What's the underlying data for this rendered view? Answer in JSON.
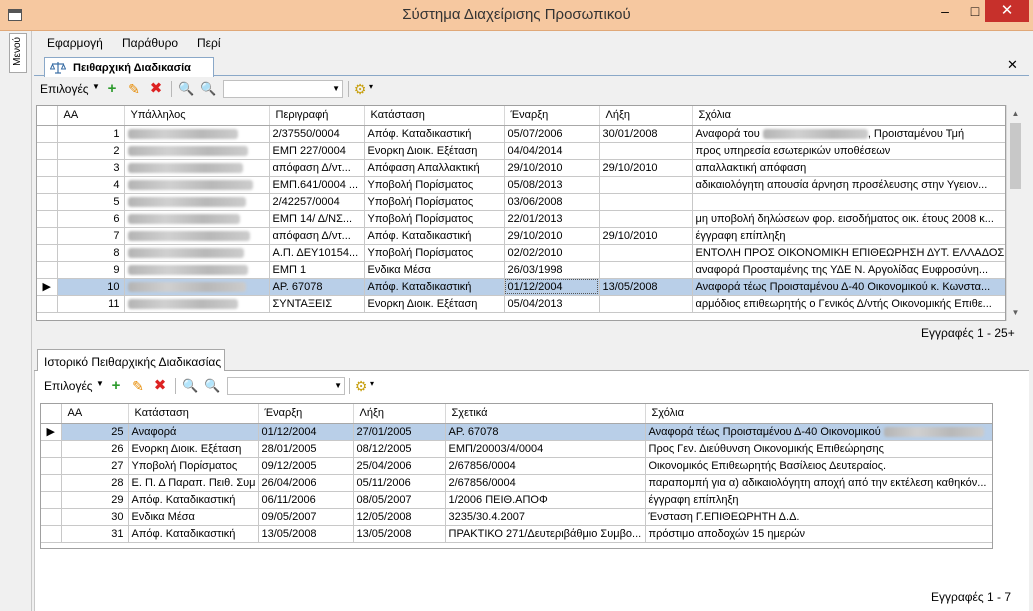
{
  "window": {
    "title": "Σύστημα Διαχείρισης Προσωπικού",
    "min": "‒",
    "max": "□",
    "close": "✕"
  },
  "side_tab": {
    "label": "Μενού"
  },
  "menu": {
    "items": [
      "Εφαρμογή",
      "Παράθυρο",
      "Περί"
    ]
  },
  "doc_tab": {
    "label": "Πειθαρχική Διαδικασία",
    "close": "✕"
  },
  "toolbar": {
    "options_label": "Επιλογές",
    "caret": "▼",
    "add": "+",
    "edit": "✎",
    "delete": "✖",
    "search": "🔍",
    "search_adv": "🔍",
    "combo_arrow": "▼",
    "gear": "⚙",
    "gear_caret": "▾"
  },
  "main_grid": {
    "columns": [
      "",
      "ΑΑ",
      "Υπάλληλος",
      "Περιγραφή",
      "Κατάσταση",
      "Έναρξη",
      "Λήξη",
      "Σχόλια"
    ],
    "selected_marker": "▶",
    "rows": [
      {
        "aa": "1",
        "employee": "",
        "desc": "2/37550/0004",
        "status": "Απόφ. Καταδικαστική",
        "start": "05/07/2006",
        "end": "30/01/2008",
        "comment": "Αναφορά του",
        "comment_tail": ", Προισταμένου Τμή"
      },
      {
        "aa": "2",
        "employee": "",
        "desc": "ΕΜΠ 227/0004",
        "status": "Ενορκη Διοικ. Εξέταση",
        "start": "04/04/2014",
        "end": "",
        "comment": "προς υπηρεσία εσωτερικών υποθέσεων"
      },
      {
        "aa": "3",
        "employee": "",
        "desc": "απόφαση Δ/ντ...",
        "status": "Απόφαση Απαλλακτική",
        "start": "29/10/2010",
        "end": "29/10/2010",
        "comment": "απαλλακτική απόφαση"
      },
      {
        "aa": "4",
        "employee": "",
        "desc": "ΕΜΠ.641/0004 ...",
        "status": "Υποβολή Πορίσματος",
        "start": "05/08/2013",
        "end": "",
        "comment": "αδικαιολόγητη απουσία άρνηση προσέλευσης στην Υγειον..."
      },
      {
        "aa": "5",
        "employee": "",
        "desc": "2/42257/0004",
        "status": "Υποβολή Πορίσματος",
        "start": "03/06/2008",
        "end": "",
        "comment": ""
      },
      {
        "aa": "6",
        "employee": "",
        "desc": "ΕΜΠ 14/ Δ/ΝΣ...",
        "status": "Υποβολή Πορίσματος",
        "start": "22/01/2013",
        "end": "",
        "comment": "μη υποβολή δηλώσεων φορ. εισοδήματος οικ. έτους 2008 κ..."
      },
      {
        "aa": "7",
        "employee": "",
        "desc": "απόφαση Δ/ντ...",
        "status": "Απόφ. Καταδικαστική",
        "start": "29/10/2010",
        "end": "29/10/2010",
        "comment": "έγγραφη επίπληξη"
      },
      {
        "aa": "8",
        "employee": "",
        "desc": "Α.Π. ΔΕΥ10154...",
        "status": "Υποβολή Πορίσματος",
        "start": "02/02/2010",
        "end": "",
        "comment": "ΕΝΤΟΛΗ ΠΡΟΣ ΟΙΚΟΝΟΜΙΚΗ ΕΠΙΘΕΩΡΗΣΗ ΔΥΤ. ΕΛΛΑΔΟΣ.ΕΠ..."
      },
      {
        "aa": "9",
        "employee": "",
        "desc": "ΕΜΠ 1",
        "status": "Ενδικα Μέσα",
        "start": "26/03/1998",
        "end": "",
        "comment": "αναφορά Προσταμένης της ΥΔΕ Ν. Αργολίδας Ευφροσύνη..."
      },
      {
        "aa": "10",
        "employee": "",
        "desc": "ΑΡ. 67078",
        "status": "Απόφ. Καταδικαστική",
        "start": "01/12/2004",
        "end": "13/05/2008",
        "comment": "Αναφορά τέως Προισταμένου Δ-40 Οικονομικού κ. Κωνστα..."
      },
      {
        "aa": "11",
        "employee": "",
        "desc": "ΣΥΝΤΑΞΕΙΣ",
        "status": "Ενορκη Διοικ. Εξέταση",
        "start": "05/04/2013",
        "end": "",
        "comment": "αρμόδιος επιθεωρητής ο Γενικός Δ/ντής Οικονομικής Επιθε..."
      }
    ],
    "records": "Εγγραφές 1 - 25+"
  },
  "history_tab": {
    "label": "Ιστορικό Πειθαρχικής Διαδικασίας"
  },
  "history_grid": {
    "columns": [
      "",
      "ΑΑ",
      "Κατάσταση",
      "Έναρξη",
      "Λήξη",
      "Σχετικά",
      "Σχόλια"
    ],
    "selected_marker": "▶",
    "rows": [
      {
        "aa": "25",
        "status": "Αναφορά",
        "start": "01/12/2004",
        "end": "27/01/2005",
        "related": "ΑΡ. 67078",
        "comment": "Αναφορά τέως Προισταμένου Δ-40 Οικονομικού"
      },
      {
        "aa": "26",
        "status": "Ενορκη Διοικ. Εξέταση",
        "start": "28/01/2005",
        "end": "08/12/2005",
        "related": "ΕΜΠ/20003/4/0004",
        "comment": "Προς  Γεν. Διεύθυνση Οικονομικής Επιθεώρησης"
      },
      {
        "aa": "27",
        "status": "Υποβολή Πορίσματος",
        "start": "09/12/2005",
        "end": "25/04/2006",
        "related": "2/67856/0004",
        "comment": "Οικονομικός Επιθεωρητής Βασίλειος Δευτεραίος."
      },
      {
        "aa": "28",
        "status": "Ε. Π. Δ Παραπ. Πειθ. Συμ",
        "start": "26/04/2006",
        "end": "05/11/2006",
        "related": "2/67856/0004",
        "comment": "παραπομπή για α) αδικαιολόγητη αποχή από την εκτέλεση καθηκόν..."
      },
      {
        "aa": "29",
        "status": "Απόφ. Καταδικαστική",
        "start": "06/11/2006",
        "end": "08/05/2007",
        "related": "1/2006 ΠΕΙΘ.ΑΠΟΦ",
        "comment": "έγγραφη επίπληξη"
      },
      {
        "aa": "30",
        "status": "Ενδικα Μέσα",
        "start": "09/05/2007",
        "end": "12/05/2008",
        "related": "3235/30.4.2007",
        "comment": "Ένσταση Γ.ΕΠΙΘΕΩΡΗΤΗ Δ.Δ."
      },
      {
        "aa": "31",
        "status": "Απόφ. Καταδικαστική",
        "start": "13/05/2008",
        "end": "13/05/2008",
        "related": "ΠΡΑΚΤΙΚΟ 271/Δευτεριβάθμιο Συμβο...",
        "comment": "πρόστιμο αποδοχών 15 ημερών"
      }
    ],
    "records": "Εγγραφές 1 - 7"
  },
  "colors": {
    "titlebar": "#f6c8a0",
    "close_button": "#c7302b",
    "selected_row": "#b9cfe8",
    "add_icon": "#2c9a2c",
    "edit_icon": "#e68a00",
    "delete_icon": "#dd2222"
  }
}
